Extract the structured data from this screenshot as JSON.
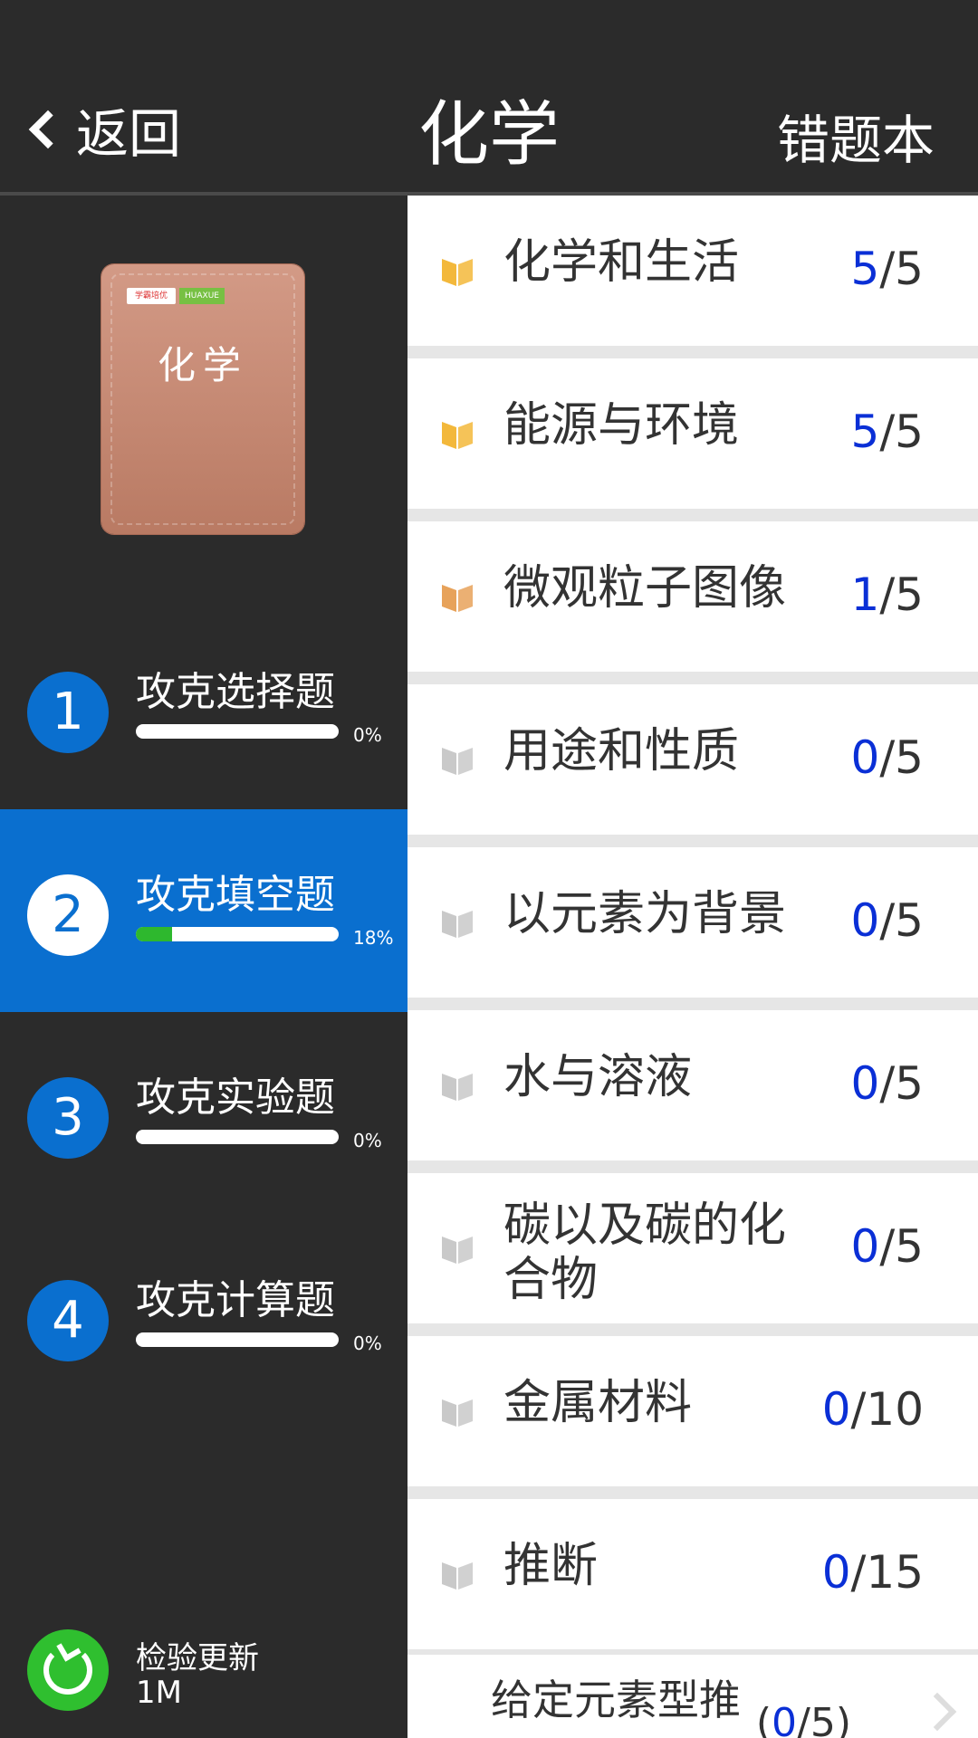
{
  "header": {
    "back_label": "返回",
    "title": "化学",
    "wrong_book_label": "错题本"
  },
  "book": {
    "logo_text": "学霸培优",
    "logo_badge": "HUAXUE",
    "cover_title": "化学"
  },
  "modes": [
    {
      "num": "1",
      "name": "攻克选择题",
      "percent": "0%",
      "progress": 0,
      "active": false
    },
    {
      "num": "2",
      "name": "攻克填空题",
      "percent": "18%",
      "progress": 0.18,
      "active": true
    },
    {
      "num": "3",
      "name": "攻克实验题",
      "percent": "0%",
      "progress": 0,
      "active": false
    },
    {
      "num": "4",
      "name": "攻克计算题",
      "percent": "0%",
      "progress": 0,
      "active": false
    }
  ],
  "update": {
    "label": "检验更新",
    "size": "1M",
    "icon": "refresh-icon"
  },
  "topics": [
    {
      "label": "化学和生活",
      "done": "5",
      "total": "/5",
      "icon_color": "#f3b83b"
    },
    {
      "label": "能源与环境",
      "done": "5",
      "total": "/5",
      "icon_color": "#f3b83b"
    },
    {
      "label": "微观粒子图像",
      "done": "1",
      "total": "/5",
      "icon_color": "#e7a25a"
    },
    {
      "label": "用途和性质",
      "done": "0",
      "total": "/5",
      "icon_color": "#c9c9c9"
    },
    {
      "label": "以元素为背景",
      "done": "0",
      "total": "/5",
      "icon_color": "#c9c9c9"
    },
    {
      "label": "水与溶液",
      "done": "0",
      "total": "/5",
      "icon_color": "#c9c9c9"
    },
    {
      "label": "碳以及碳的化合物",
      "done": "0",
      "total": "/5",
      "icon_color": "#c9c9c9"
    },
    {
      "label": "金属材料",
      "done": "0",
      "total": "/10",
      "icon_color": "#c9c9c9"
    },
    {
      "label": "推断",
      "done": "0",
      "total": "/15",
      "icon_color": "#c9c9c9"
    }
  ],
  "subtopic": {
    "label": "给定元素型推",
    "score_open": "(",
    "done": "0",
    "total": "/5)"
  },
  "colors": {
    "accent_blue": "#0a6fcf",
    "score_blue": "#0a2fd6",
    "progress_green": "#2eb82e"
  }
}
